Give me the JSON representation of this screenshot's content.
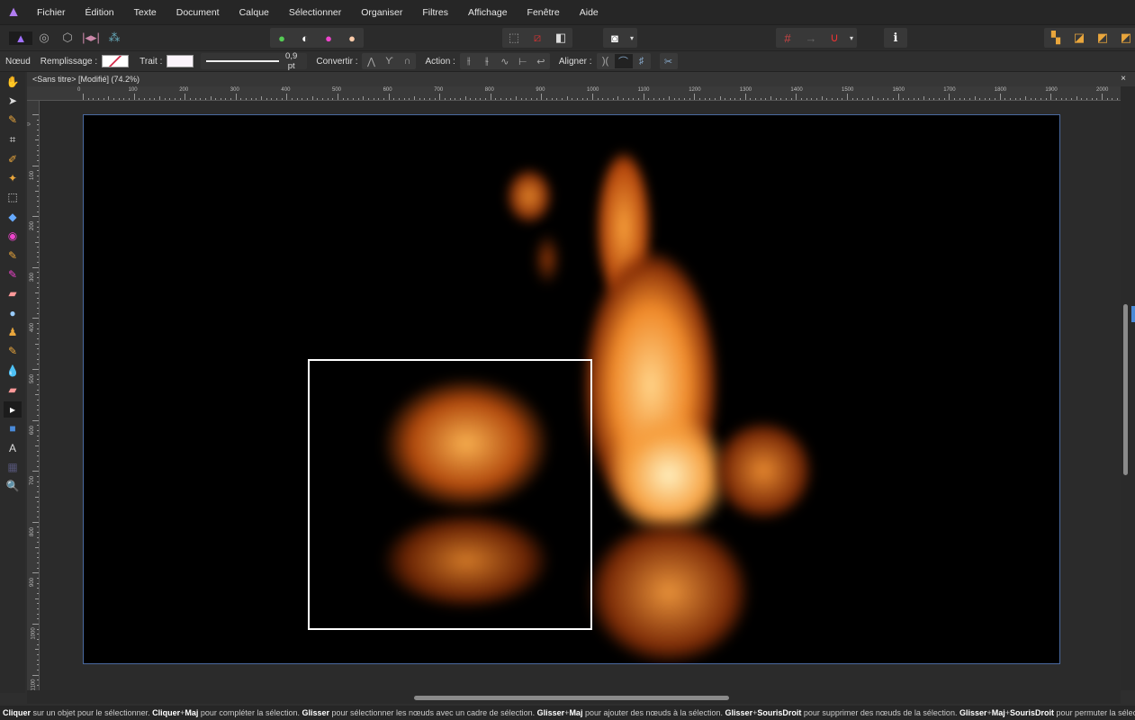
{
  "menu": {
    "items": [
      "Fichier",
      "Édition",
      "Texte",
      "Document",
      "Calque",
      "Sélectionner",
      "Organiser",
      "Filtres",
      "Affichage",
      "Fenêtre",
      "Aide"
    ]
  },
  "context": {
    "mode": "Nœud",
    "fill_label": "Remplissage :",
    "stroke_label": "Trait :",
    "stroke_width": "0,9 pt",
    "convert_label": "Convertir :",
    "action_label": "Action :",
    "align_label": "Aligner :"
  },
  "document": {
    "tab_title": "<Sans titre> [Modifié] (74.2%)",
    "close": "×"
  },
  "rulers": {
    "h": [
      "0",
      "100",
      "200",
      "300",
      "400",
      "500",
      "600",
      "700",
      "800",
      "900",
      "1000",
      "1100",
      "1200",
      "1300",
      "1400",
      "1500",
      "1600",
      "1700",
      "1800",
      "1900",
      "2000"
    ],
    "v": [
      "0",
      "100",
      "200",
      "300",
      "400",
      "500",
      "600",
      "700",
      "800",
      "900",
      "1000",
      "1100"
    ]
  },
  "status": [
    {
      "b": "Cliquer",
      "t": " sur un objet pour le sélectionner. "
    },
    {
      "b": "Cliquer",
      "t": "+"
    },
    {
      "b": "Maj",
      "t": " pour compléter la sélection. "
    },
    {
      "b": "Glisser",
      "t": " pour sélectionner les nœuds avec un cadre de sélection. "
    },
    {
      "b": "Glisser",
      "t": "+"
    },
    {
      "b": "Maj",
      "t": " pour ajouter des nœuds à la sélection. "
    },
    {
      "b": "Glisser",
      "t": "+"
    },
    {
      "b": "SourisDroit",
      "t": " pour supprimer des nœuds de la sélection. "
    },
    {
      "b": "Glisser",
      "t": "+"
    },
    {
      "b": "Maj",
      "t": "+"
    },
    {
      "b": "SourisDroit",
      "t": " pour permuter la sélection."
    }
  ]
}
